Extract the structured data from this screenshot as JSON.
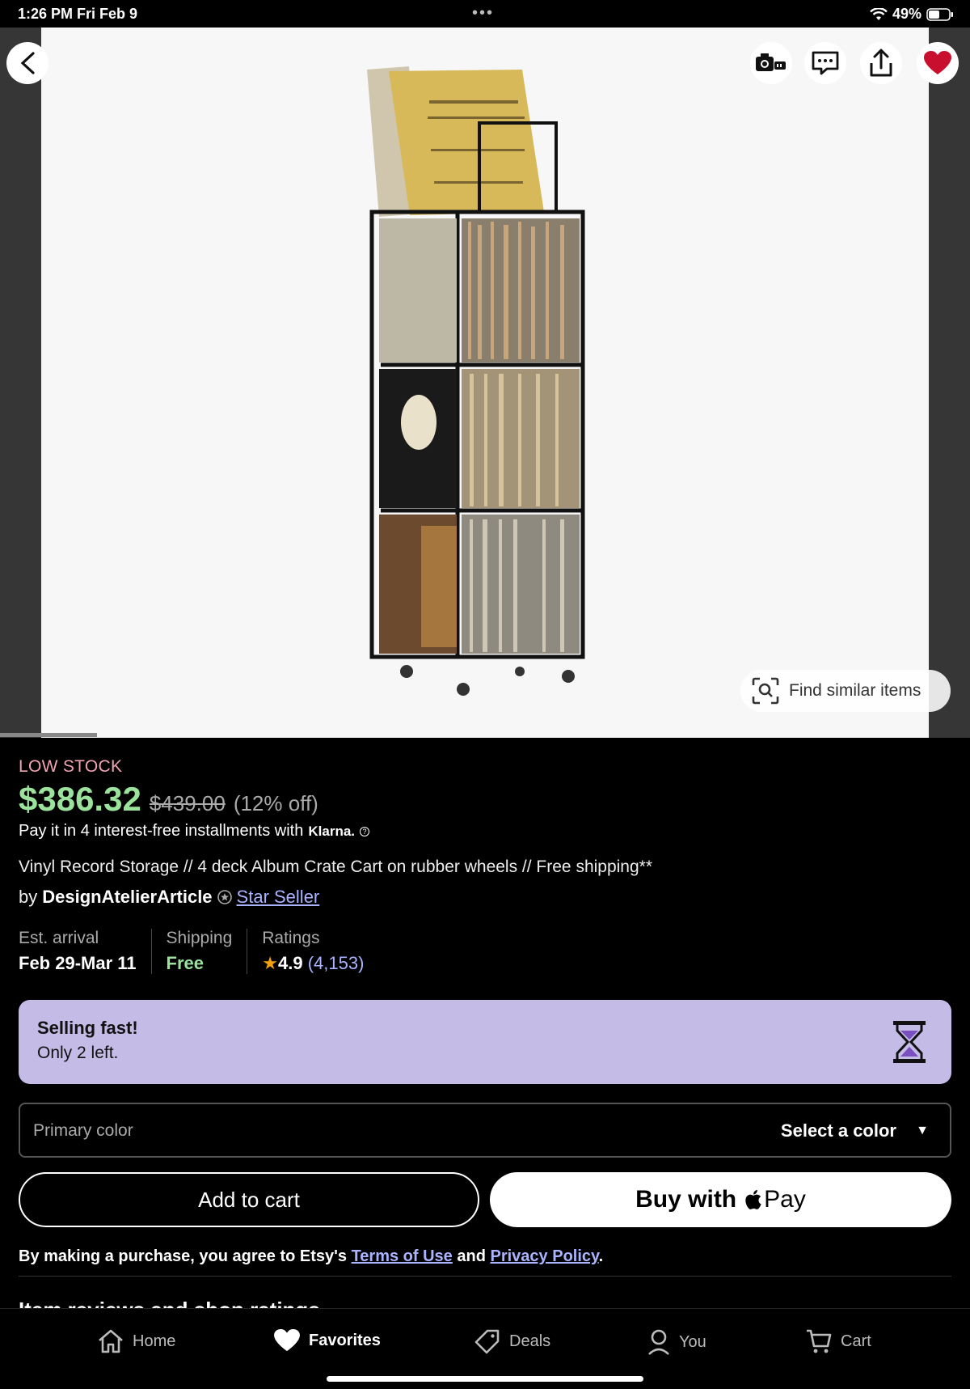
{
  "status_bar": {
    "time": "1:26 PM   Fri Feb 9",
    "battery": "49%"
  },
  "hero": {
    "find_similar_label": "Find similar items",
    "image_alt": "Vinyl record storage cart",
    "favorited": true
  },
  "product": {
    "stock_label": "LOW STOCK",
    "price": "$386.32",
    "original_price": "$439.00",
    "discount": "(12% off)",
    "klarna_text": "Pay it in 4 interest-free installments with",
    "klarna_brand": "Klarna.",
    "title": "Vinyl Record Storage // 4 deck Album Crate Cart on rubber wheels // Free shipping**",
    "by_label": "by",
    "seller": "DesignAtelierArticle",
    "seller_badge": "Star Seller"
  },
  "stats": {
    "arrival_label": "Est. arrival",
    "arrival_value": "Feb 29-Mar 11",
    "shipping_label": "Shipping",
    "shipping_value": "Free",
    "ratings_label": "Ratings",
    "rating": "4.9",
    "rating_count": "(4,153)"
  },
  "selling_fast": {
    "title": "Selling fast!",
    "subtitle": "Only 2 left."
  },
  "color_select": {
    "label": "Primary color",
    "value": "Select a color"
  },
  "actions": {
    "add_to_cart": "Add to cart",
    "buy_with": "Buy with",
    "pay": "Pay"
  },
  "legal": {
    "prefix": "By making a purchase, you agree to Etsy's",
    "terms": "Terms of Use",
    "and": "and",
    "privacy": "Privacy Policy",
    "suffix": "."
  },
  "next_section": {
    "heading": "Item reviews and shop ratings"
  },
  "tabs": [
    {
      "label": "Home",
      "icon": "home-icon"
    },
    {
      "label": "Favorites",
      "icon": "heart-icon"
    },
    {
      "label": "Deals",
      "icon": "tag-icon"
    },
    {
      "label": "You",
      "icon": "person-icon"
    },
    {
      "label": "Cart",
      "icon": "cart-icon"
    }
  ],
  "colors": {
    "price_green": "#9be39c",
    "low_stock_pink": "#f0a3b2",
    "link_blue": "#aab3ff",
    "banner_lavender": "#c4bce6",
    "heart_red": "#c8102e"
  }
}
